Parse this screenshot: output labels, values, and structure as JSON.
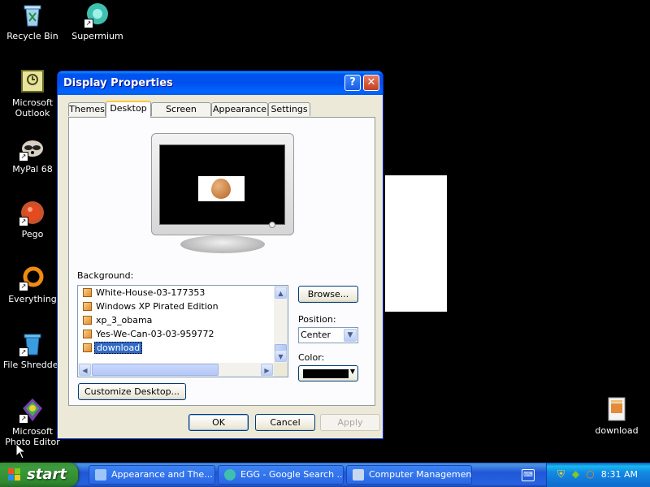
{
  "desktop": {
    "icons": [
      {
        "label": "Recycle Bin"
      },
      {
        "label": "Supermium"
      },
      {
        "label": "Microsoft Outlook"
      },
      {
        "label": "MyPal 68"
      },
      {
        "label": "Pego"
      },
      {
        "label": "Everything"
      },
      {
        "label": "File Shredder"
      },
      {
        "label": "Microsoft Photo Editor"
      },
      {
        "label": "download"
      }
    ]
  },
  "dialog": {
    "title": "Display Properties",
    "help_glyph": "?",
    "close_glyph": "✕",
    "tabs": [
      {
        "label": "Themes"
      },
      {
        "label": "Desktop"
      },
      {
        "label": "Screen Saver"
      },
      {
        "label": "Appearance"
      },
      {
        "label": "Settings"
      }
    ],
    "active_tab": "Desktop",
    "background_label": "Background:",
    "background_items": [
      {
        "label": "White-House-03-177353"
      },
      {
        "label": "Windows XP Pirated Edition"
      },
      {
        "label": "xp_3_obama"
      },
      {
        "label": "Yes-We-Can-03-03-959772"
      },
      {
        "label": "download"
      }
    ],
    "selected_background": "download",
    "browse_label": "Browse...",
    "position_label": "Position:",
    "position_value": "Center",
    "color_label": "Color:",
    "color_value": "#000000",
    "customize_label": "Customize Desktop...",
    "ok_label": "OK",
    "cancel_label": "Cancel",
    "apply_label": "Apply"
  },
  "taskbar": {
    "start_label": "start",
    "tasks": [
      {
        "label": "Appearance and The..."
      },
      {
        "label": "EGG - Google Search ..."
      },
      {
        "label": "Computer Management"
      }
    ],
    "clock": "8:31 AM"
  }
}
